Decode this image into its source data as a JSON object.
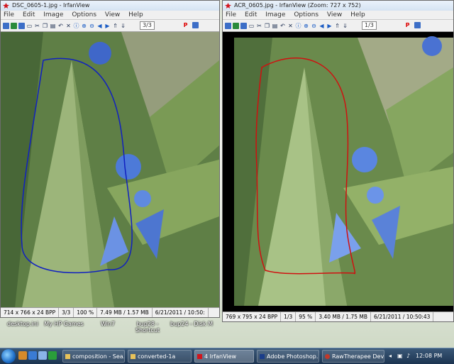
{
  "desktop": {
    "icons": [
      "desktop.ini",
      "My HP Games",
      "Win7",
      "bup28 - Shortcut",
      "bup24 - Disk M"
    ]
  },
  "windows": [
    {
      "title": "DSC_0605-1.jpg - IrfanView",
      "menu": [
        "File",
        "Edit",
        "Image",
        "Options",
        "View",
        "Help"
      ],
      "page_counter": "3/3",
      "status": [
        "714 x 766 x 24 BPP",
        "3/3",
        "100 %",
        "7.49 MB / 1.57 MB",
        "6/21/2011 / 10:50:"
      ]
    },
    {
      "title": "ACR_0605.jpg - IrfanView (Zoom: 727 x 752)",
      "menu": [
        "File",
        "Edit",
        "Image",
        "Options",
        "View",
        "Help"
      ],
      "page_counter": "1/3",
      "status": [
        "769 x 795 x 24 BPP",
        "1/3",
        "95 %",
        "3.40 MB / 1.75 MB",
        "6/21/2011 / 10:50:43"
      ]
    }
  ],
  "taskbar": {
    "buttons": [
      "composition - Sea...",
      "converted-1a",
      "4 IrfanView",
      "Adobe Photoshop...",
      "RawTherapee Dev..."
    ],
    "clock": "12:08 PM"
  },
  "colors": {
    "left_outline": "#1020c0",
    "right_outline": "#d01010",
    "irfan_logo": "#d2141c"
  }
}
